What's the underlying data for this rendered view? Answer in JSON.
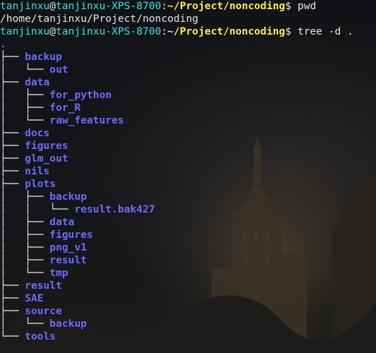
{
  "prompt": {
    "user": "tanjinxu",
    "at": "@",
    "host": "tanjinxu-XPS-8700",
    "colon": ":",
    "path": "~/Project/noncoding",
    "dollar": "$"
  },
  "commands": [
    {
      "cmd": " pwd"
    },
    {
      "cmd": " tree -d ."
    }
  ],
  "pwd_output": "/home/tanjinxu/Project/noncoding",
  "tree": {
    "root": ".",
    "lines": [
      {
        "prefix": "├── ",
        "name": "backup"
      },
      {
        "prefix": "│   └── ",
        "name": "out"
      },
      {
        "prefix": "├── ",
        "name": "data"
      },
      {
        "prefix": "│   ├── ",
        "name": "for_python"
      },
      {
        "prefix": "│   ├── ",
        "name": "for_R"
      },
      {
        "prefix": "│   └── ",
        "name": "raw_features"
      },
      {
        "prefix": "├── ",
        "name": "docs"
      },
      {
        "prefix": "├── ",
        "name": "figures"
      },
      {
        "prefix": "├── ",
        "name": "glm_out"
      },
      {
        "prefix": "├── ",
        "name": "nils"
      },
      {
        "prefix": "├── ",
        "name": "plots"
      },
      {
        "prefix": "│   ├── ",
        "name": "backup"
      },
      {
        "prefix": "│   │   └── ",
        "name": "result.bak427"
      },
      {
        "prefix": "│   ├── ",
        "name": "data"
      },
      {
        "prefix": "│   ├── ",
        "name": "figures"
      },
      {
        "prefix": "│   ├── ",
        "name": "png_v1"
      },
      {
        "prefix": "│   ├── ",
        "name": "result"
      },
      {
        "prefix": "│   └── ",
        "name": "tmp"
      },
      {
        "prefix": "├── ",
        "name": "result"
      },
      {
        "prefix": "├── ",
        "name": "SAE"
      },
      {
        "prefix": "├── ",
        "name": "source"
      },
      {
        "prefix": "│   └── ",
        "name": "backup"
      },
      {
        "prefix": "└── ",
        "name": "tools"
      }
    ]
  },
  "colors": {
    "user_host": "#34e2e2",
    "path": "#fce94f",
    "directory": "#6b6bff",
    "text": "#e6e6e6",
    "background": "#111214"
  }
}
